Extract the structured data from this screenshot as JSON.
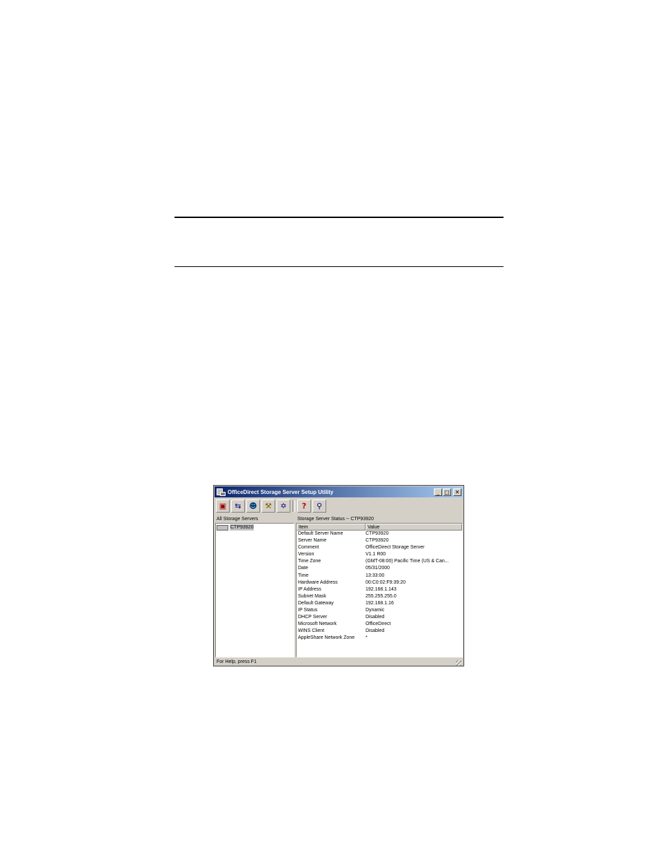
{
  "window": {
    "title": "OfficeDirect Storage Server Setup Utility",
    "minimize_glyph": "_",
    "maximize_glyph": "□",
    "close_glyph": "✕"
  },
  "toolbar": {
    "buttons": [
      {
        "icon": "server-config-icon",
        "glyph": "▣"
      },
      {
        "icon": "network-icon",
        "glyph": "⇆"
      },
      {
        "icon": "users-icon",
        "glyph": "☻"
      },
      {
        "icon": "tools-icon",
        "glyph": "⚒"
      },
      {
        "icon": "star-icon",
        "glyph": "✡"
      },
      {
        "icon": "help-icon",
        "glyph": "?"
      },
      {
        "icon": "exit-icon",
        "glyph": "⚲"
      }
    ]
  },
  "left_pane": {
    "header": "All Storage Servers",
    "items": [
      {
        "label": "CTP93920"
      }
    ]
  },
  "right_pane": {
    "header": "Storage Server Status -- CTP93920",
    "columns": {
      "item": "Item",
      "value": "Value"
    },
    "rows": [
      {
        "item": "Default Server Name",
        "value": "CTP93920"
      },
      {
        "item": "Server Name",
        "value": "CTP93920"
      },
      {
        "item": "Comment",
        "value": "OfficeDirect Storage Server"
      },
      {
        "item": "Version",
        "value": "V1.1 R00"
      },
      {
        "item": "Time Zone",
        "value": "(GMT-08:00) Pacific Time (US & Can..."
      },
      {
        "item": "Date",
        "value": "05/31/2000"
      },
      {
        "item": "Time",
        "value": "13:33:00"
      },
      {
        "item": "Hardware Address",
        "value": "00:C0:02:F9:39:20"
      },
      {
        "item": "IP Address",
        "value": "192.168.1.143"
      },
      {
        "item": "Subnet Mask",
        "value": "255.255.255.0"
      },
      {
        "item": "Default Gateway",
        "value": "192.168.1.16"
      },
      {
        "item": "IP Status",
        "value": "Dynamic"
      },
      {
        "item": "DHCP Server",
        "value": "Disabled"
      },
      {
        "item": "Microsoft Network",
        "value": "OfficeDirect"
      },
      {
        "item": "WINS Client",
        "value": "Disabled"
      },
      {
        "item": "AppleShare Network Zone",
        "value": "*"
      }
    ]
  },
  "statusbar": {
    "text": "For Help, press F1"
  }
}
